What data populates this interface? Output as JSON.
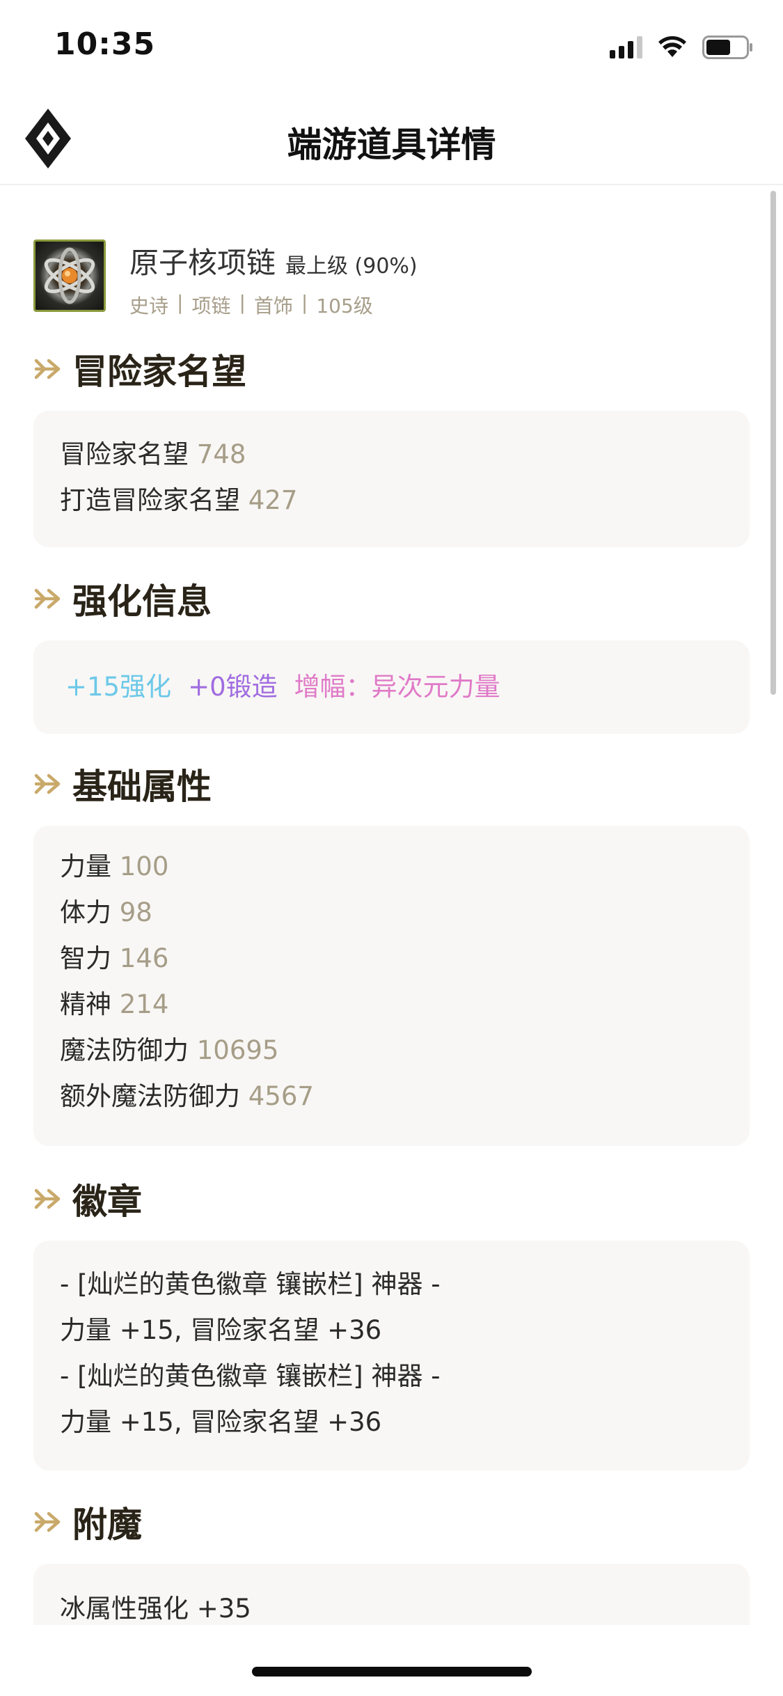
{
  "status_bar": {
    "time": "10:35"
  },
  "nav": {
    "title": "端游道具详情",
    "logo_icon": "diamond-logo-icon"
  },
  "item": {
    "icon": "atom-necklace-icon",
    "name": "原子核项链",
    "level_label": "最上级 (90%)",
    "tags": [
      "史诗",
      "项链",
      "首饰",
      "105级"
    ]
  },
  "colors": {
    "value": "#a69d88",
    "arrow": "#c9a96a",
    "enhance": "#6cc8e8",
    "forge": "#a06ce0",
    "amplify": "#e07ac8"
  },
  "sections": {
    "fame": {
      "title": "冒险家名望",
      "rows": [
        {
          "label": "冒险家名望",
          "value": "748"
        },
        {
          "label": "打造冒险家名望",
          "value": "427"
        }
      ]
    },
    "enhance": {
      "title": "强化信息",
      "enhance": "+15强化",
      "forge": "+0锻造",
      "amplify": "增幅：异次元力量"
    },
    "base": {
      "title": "基础属性",
      "rows": [
        {
          "label": "力量",
          "value": "100"
        },
        {
          "label": "体力",
          "value": "98"
        },
        {
          "label": "智力",
          "value": "146"
        },
        {
          "label": "精神",
          "value": "214"
        },
        {
          "label": "魔法防御力",
          "value": "10695"
        },
        {
          "label": "额外魔法防御力",
          "value": "4567"
        }
      ]
    },
    "emblem": {
      "title": "徽章",
      "lines": [
        "- [灿烂的黄色徽章 镶嵌栏] 神器 -",
        "力量 +15, 冒险家名望 +36",
        "- [灿烂的黄色徽章 镶嵌栏] 神器 -",
        "力量 +15, 冒险家名望 +36"
      ]
    },
    "enchant": {
      "title": "附魔",
      "lines": [
        "冰属性强化 +35"
      ]
    }
  }
}
